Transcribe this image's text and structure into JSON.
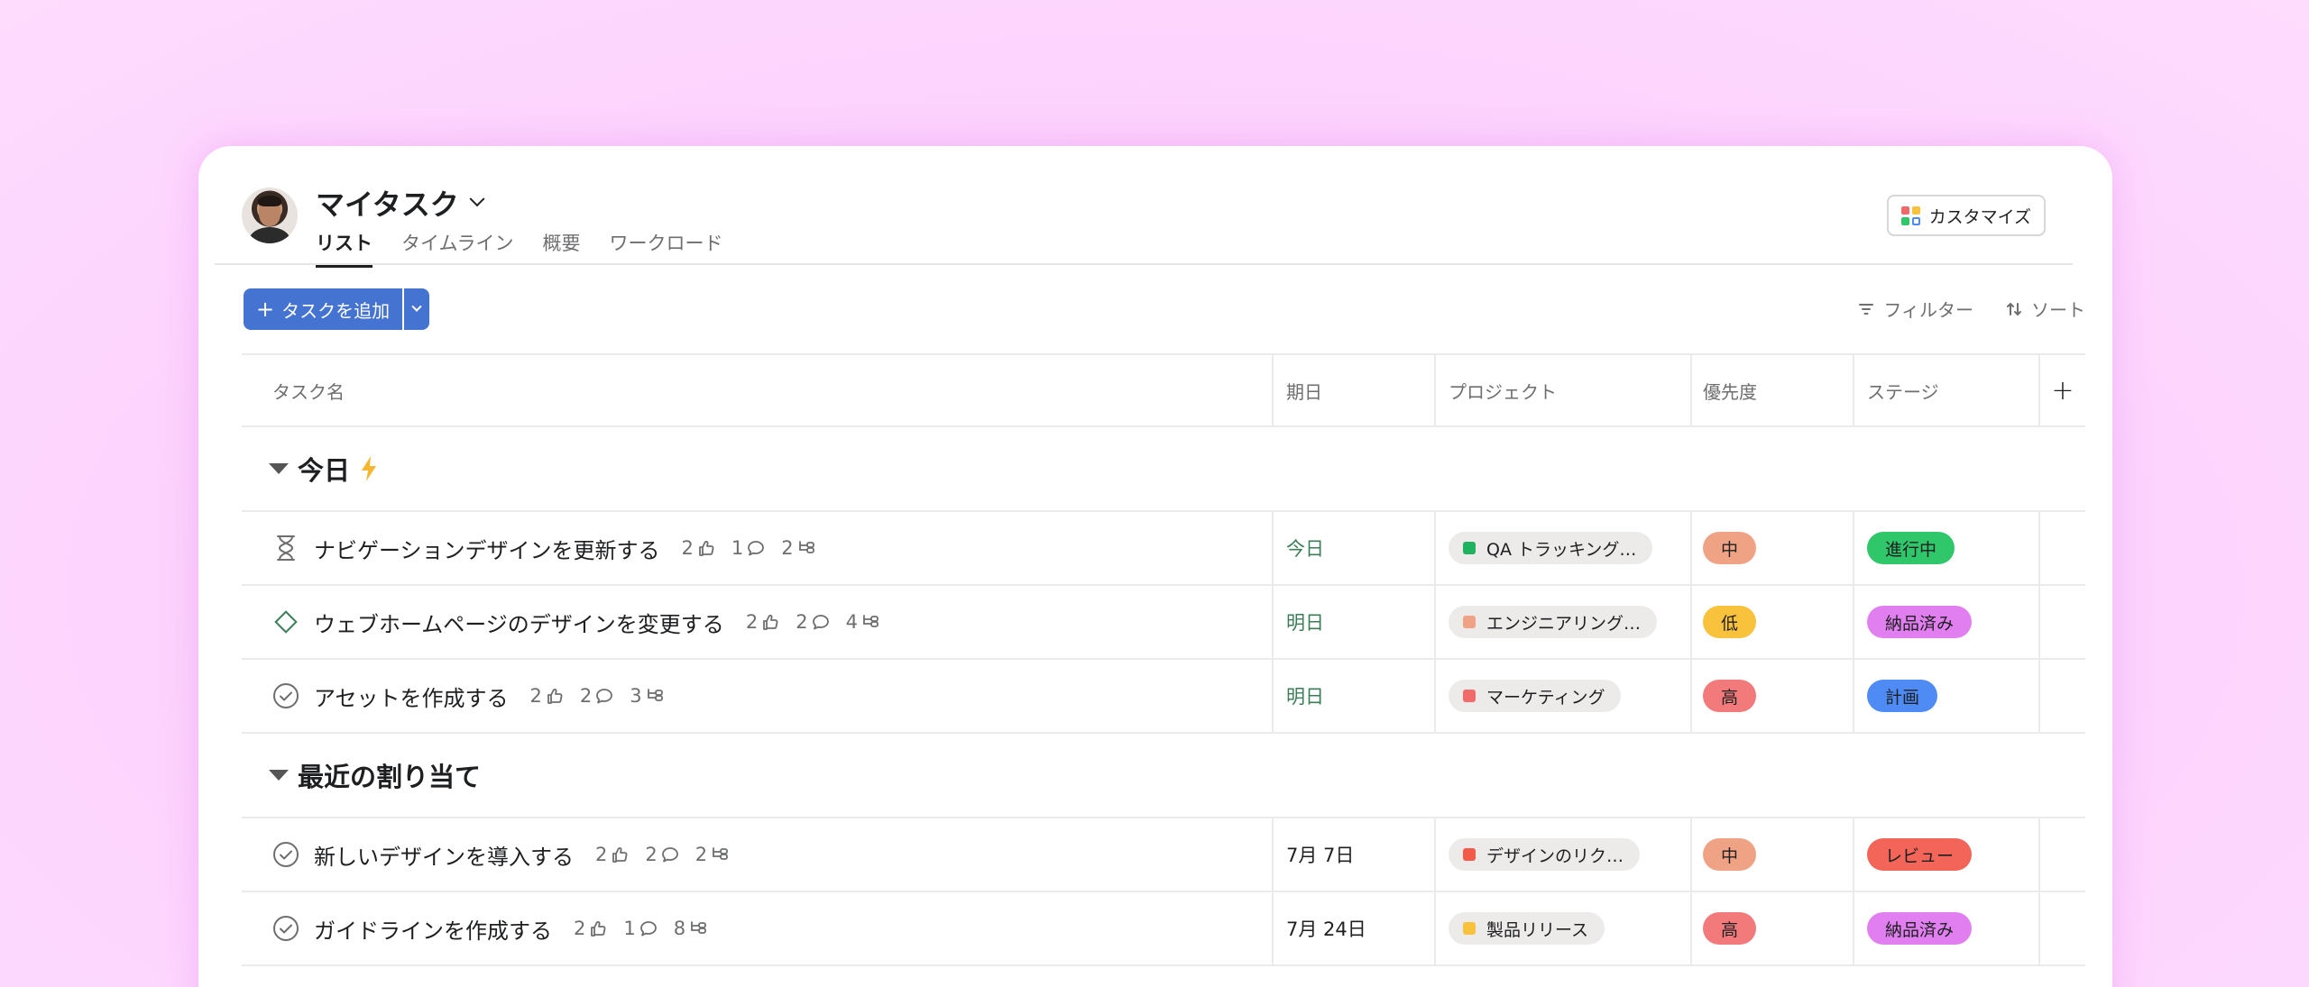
{
  "header": {
    "title": "マイタスク",
    "tabs": [
      {
        "label": "リスト",
        "active": true
      },
      {
        "label": "タイムライン",
        "active": false
      },
      {
        "label": "概要",
        "active": false
      },
      {
        "label": "ワークロード",
        "active": false
      }
    ],
    "customize_label": "カスタマイズ"
  },
  "toolbar": {
    "add_label": "タスクを追加",
    "filter_label": "フィルター",
    "sort_label": "ソート"
  },
  "columns": {
    "name": "タスク名",
    "date": "期日",
    "project": "プロジェクト",
    "priority": "優先度",
    "stage": "ステージ"
  },
  "sections": [
    {
      "title": "今日",
      "tasks": [
        {
          "icon": "hourglass-icon",
          "name": "ナビゲーションデザインを更新する",
          "likes": "2",
          "comments": "1",
          "subtasks": "2",
          "date": "今日",
          "date_color": "#3b7d57",
          "project": "QA トラッキング…",
          "project_color": "#1fb35f",
          "priority": "中",
          "priority_color": "#f0a384",
          "stage": "進行中",
          "stage_color": "#2fc76a"
        },
        {
          "icon": "diamond-icon",
          "name": "ウェブホームページのデザインを変更する",
          "likes": "2",
          "comments": "2",
          "subtasks": "4",
          "date": "明日",
          "date_color": "#3b7d57",
          "project": "エンジニアリング…",
          "project_color": "#f0a384",
          "priority": "低",
          "priority_color": "#f9c23c",
          "stage": "納品済み",
          "stage_color": "#e27ff0"
        },
        {
          "icon": "check-circle-icon",
          "name": "アセットを作成する",
          "likes": "2",
          "comments": "2",
          "subtasks": "3",
          "date": "明日",
          "date_color": "#3b7d57",
          "project": "マーケティング",
          "project_color": "#f26b6b",
          "priority": "高",
          "priority_color": "#f27a7a",
          "stage": "計画",
          "stage_color": "#4e8bf5"
        }
      ]
    },
    {
      "title": "最近の割り当て",
      "tasks": [
        {
          "icon": "check-circle-icon",
          "name": "新しいデザインを導入する",
          "likes": "2",
          "comments": "2",
          "subtasks": "2",
          "date": "7月 7日",
          "date_color": "#1e1f21",
          "project": "デザインのリク…",
          "project_color": "#f25a4a",
          "priority": "中",
          "priority_color": "#f0a384",
          "stage": "レビュー",
          "stage_color": "#f26558"
        },
        {
          "icon": "check-circle-icon",
          "name": "ガイドラインを作成する",
          "likes": "2",
          "comments": "1",
          "subtasks": "8",
          "date": "7月 24日",
          "date_color": "#1e1f21",
          "project": "製品リリース",
          "project_color": "#f9c23c",
          "priority": "高",
          "priority_color": "#f27a7a",
          "stage": "納品済み",
          "stage_color": "#e27ff0"
        }
      ]
    }
  ]
}
